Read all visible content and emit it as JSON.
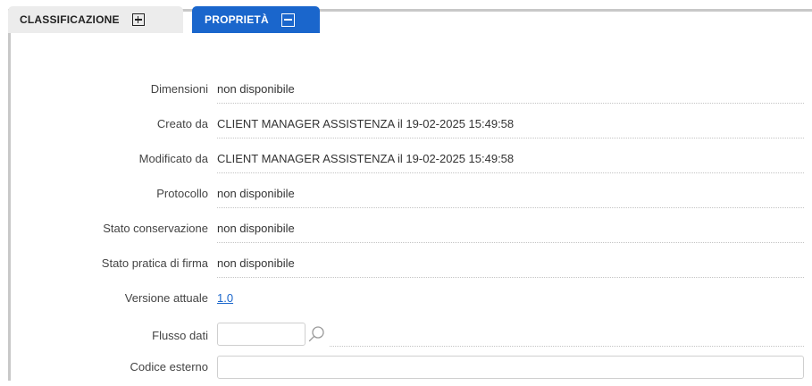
{
  "tabs": [
    {
      "label": "CLASSIFICAZIONE",
      "state": "collapsed"
    },
    {
      "label": "PROPRIETÀ",
      "state": "expanded"
    }
  ],
  "properties": [
    {
      "label": "Dimensioni",
      "value": "non disponibile"
    },
    {
      "label": "Creato da",
      "value": "CLIENT MANAGER ASSISTENZA il 19-02-2025 15:49:58"
    },
    {
      "label": "Modificato da",
      "value": "CLIENT MANAGER ASSISTENZA il 19-02-2025 15:49:58"
    },
    {
      "label": "Protocollo",
      "value": "non disponibile"
    },
    {
      "label": "Stato conservazione",
      "value": "non disponibile"
    },
    {
      "label": "Stato pratica di firma",
      "value": "non disponibile"
    },
    {
      "label": "Versione attuale",
      "value": "1.0"
    }
  ],
  "fields": {
    "flusso_dati": {
      "label": "Flusso dati",
      "value": ""
    },
    "codice_esterno": {
      "label": "Codice esterno",
      "value": ""
    }
  },
  "colors": {
    "accent": "#1a66cc",
    "tab_inactive": "#ececec"
  }
}
